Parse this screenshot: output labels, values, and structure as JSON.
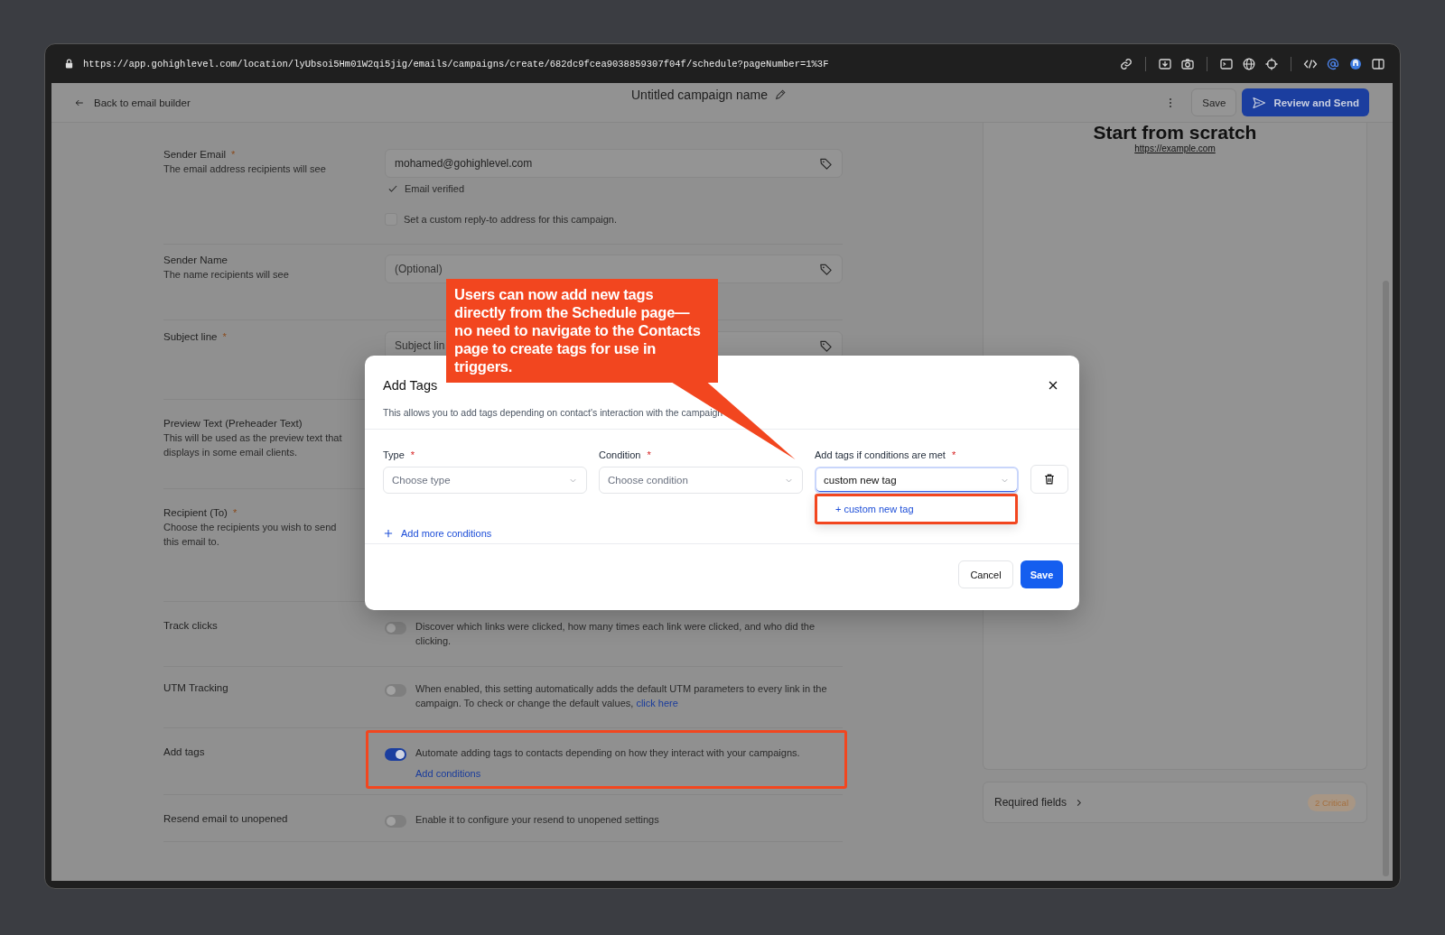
{
  "browser": {
    "url": "https://app.gohighlevel.com/location/lyUbsoi5Hm01W2qi5jig/emails/campaigns/create/682dc9fcea9038859307f04f/schedule?pageNumber=1%3F"
  },
  "header": {
    "back_label": "Back to email builder",
    "campaign_name": "Untitled campaign name",
    "save_label": "Save",
    "send_label": "Review and Send"
  },
  "form": {
    "rows": [
      {
        "kind": "field",
        "label": "Sender Email",
        "required": "*",
        "hint": "The email address recipients will see",
        "value": "mohamed@gohighlevel.com",
        "verified": "Email verified",
        "checkbox": {
          "label": "Set a custom reply-to address for this campaign.",
          "checked": false
        }
      },
      {
        "kind": "field",
        "label": "Sender Name",
        "hint": "The name recipients will see",
        "placeholder": "(Optional)"
      },
      {
        "kind": "field",
        "label": "Subject line",
        "required": "*",
        "placeholder": "Subject lin"
      },
      {
        "kind": "field",
        "label": "Preview Text (Preheader Text)",
        "hint": "This will be used as the preview text that displays in some email clients."
      },
      {
        "kind": "field",
        "label": "Recipient (To)",
        "required": "*",
        "hint": "Choose the recipients you wish to send this email to."
      },
      {
        "kind": "toggle",
        "label": "Track clicks",
        "on": false,
        "highlighted": false,
        "text": "Discover which links were clicked, how many times each link were clicked, and who did the clicking."
      },
      {
        "kind": "toggle",
        "label": "UTM Tracking",
        "on": false,
        "highlighted": false,
        "text": "When enabled, this setting automatically adds the default UTM parameters to every link in the campaign. To check or change the default values,",
        "inline_link": "click here"
      },
      {
        "kind": "toggle",
        "label": "Add tags",
        "on": true,
        "highlighted": true,
        "text": "Automate adding tags to contacts depending on how they interact with your campaigns.",
        "link": "Add conditions"
      },
      {
        "kind": "toggle",
        "label": "Resend email to unopened",
        "on": false,
        "highlighted": false,
        "text": "Enable it to configure your resend to unopened settings"
      }
    ]
  },
  "preview": {
    "title": "Start from scratch",
    "link": "https://example.com"
  },
  "required_fields": {
    "label": "Required fields",
    "badge": "2 Critical"
  },
  "modal": {
    "title": "Add Tags",
    "description": "This allows you to add tags depending on contact's interaction with the campaign",
    "fields": [
      {
        "label": "Type",
        "required": "*",
        "placeholder": "Choose type",
        "focused": false
      },
      {
        "label": "Condition",
        "required": "*",
        "placeholder": "Choose condition",
        "focused": false
      },
      {
        "label": "Add tags if conditions are met",
        "required": "*",
        "value": "custom new tag",
        "focused": true
      }
    ],
    "option": {
      "label": "+ custom new tag",
      "highlighted": true
    },
    "add_more": "Add more conditions",
    "cancel": "Cancel",
    "save": "Save"
  },
  "callout": {
    "text": "Users can now add new tags directly from the Schedule page—no need to navigate to the Contacts page to create tags for use in triggers."
  }
}
